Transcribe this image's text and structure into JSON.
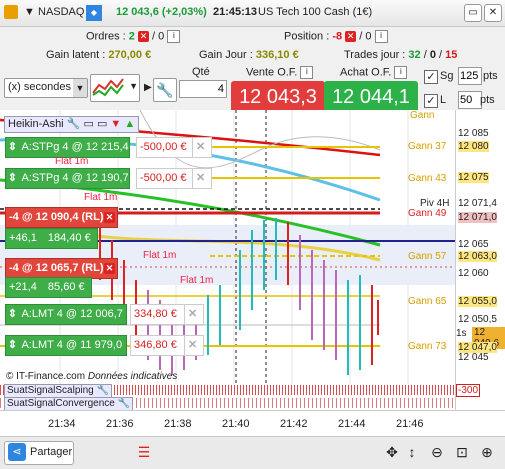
{
  "titlebar": {
    "symbol": "NASDAQ",
    "price_change": "12 043,6 (+2,03%)",
    "time": "21:45:13",
    "instrument": "US Tech 100 Cash (1€)"
  },
  "stats": {
    "orders_label": "Ordres :",
    "orders_count": "2",
    "orders_total": "/ 0",
    "position_label": "Position :",
    "position_value": "-8",
    "position_total": "/ 0",
    "latent_label": "Gain latent :",
    "latent_value": "270,00 €",
    "day_label": "Gain Jour :",
    "day_value": "336,10 €",
    "trades_label": "Trades jour :",
    "trades_a": "32",
    "trades_sep": "/",
    "trades_b": "0",
    "trades_c": "15"
  },
  "toolbar": {
    "timeframe": "(x) secondes",
    "qty_label": "Qté",
    "qty_value": "4",
    "sell_label": "Vente O.F.",
    "buy_label": "Achat O.F.",
    "sell_price": "12 043,3",
    "buy_price": "12 044,1",
    "sg_label": "Sg",
    "sg_value": "125",
    "sg_unit": "pts",
    "l_label": "L",
    "l_value": "50",
    "l_unit": "pts"
  },
  "chart": {
    "indicator": "Heikin-Ashi",
    "orders": [
      {
        "label": "A:STPg  4 @ 12 215,4",
        "value": "-500,00 €"
      },
      {
        "label": "A:STPg  4 @ 12 190,7",
        "value": "-500,00 €"
      },
      {
        "label": "-4 @ 12 090,4 (RL)",
        "pnl": "+46,1",
        "value": "184,40 €"
      },
      {
        "label": "-4 @ 12 065,7 (RL)",
        "pnl": "+21,4",
        "value": "85,60 €"
      },
      {
        "label": "A:LMT  4 @ 12 006,7",
        "value": "334,80 €"
      },
      {
        "label": "A:LMT  4 @ 11 979,0",
        "value": "346,80 €"
      }
    ],
    "gann": [
      "Gann 37",
      "Gann 43",
      "Piv 4H",
      "Gann 49",
      "Gann 57",
      "Gann 65",
      "Gann 73"
    ],
    "gann_top": "Gann",
    "yaxis": [
      "12 085",
      "12 080",
      "12 075",
      "12 071,4",
      "12 071,0",
      "12 065",
      "12 063,0",
      "12 060",
      "12 055,0",
      "12 050,5",
      "12 049,6",
      "12 047,0",
      "12 045"
    ],
    "bid_label": "1s",
    "xaxis": [
      "21:34",
      "21:36",
      "21:38",
      "21:40",
      "21:42",
      "21:44",
      "21:46"
    ],
    "copyright": "© IT-Finance.com",
    "data_note": "Données indicatives",
    "flat_label": "Flat 1m",
    "sub1": "SuatSignalScalping",
    "sub2": "SuatSignalConvergence",
    "sub_value": "-300"
  },
  "bottombar": {
    "share": "Partager"
  }
}
